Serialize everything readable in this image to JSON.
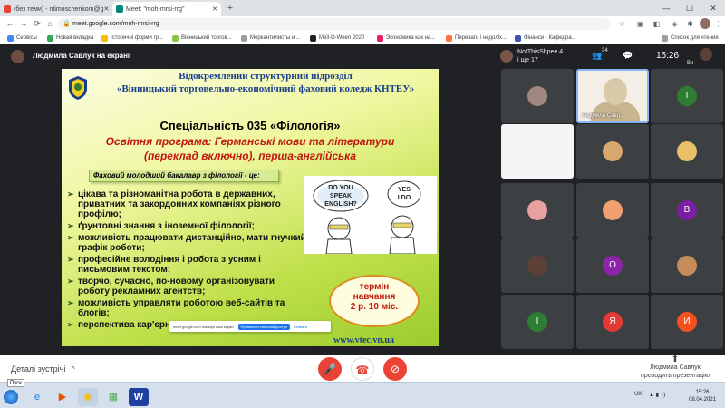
{
  "browser": {
    "tabs": [
      {
        "label": "(без теми) - ntimoschenkom@g",
        "favicon_color": "#ea4335"
      },
      {
        "label": "Meet: \"moh-mrsi-rrg\"",
        "favicon_color": "#00897b"
      }
    ],
    "new_tab": "+",
    "window_controls": {
      "minimize": "—",
      "maximize": "☐",
      "close": "✕"
    },
    "url": "meet.google.com/moh-mrsi-rrg",
    "lock_icon": "🔒",
    "nav": {
      "back": "←",
      "forward": "→",
      "reload": "⟳",
      "home": "⌂"
    },
    "toolbar_icons": {
      "star": "☆",
      "extensions": "⋮"
    }
  },
  "bookmarks": [
    {
      "label": "Сервісы",
      "color": "#4285f4"
    },
    {
      "label": "Новая вкладка",
      "color": "#34a853"
    },
    {
      "label": "Історичні форми гр...",
      "color": "#fbbc05"
    },
    {
      "label": "Вінницький торгов...",
      "color": "#8bc34a"
    },
    {
      "label": "Меркантилисты и ...",
      "color": "#9e9e9e"
    },
    {
      "label": "Mell-O-Ween 2020",
      "color": "#212121"
    },
    {
      "label": "Экономика как на...",
      "color": "#e91e63"
    },
    {
      "label": "Переваги і недоліх...",
      "color": "#ff7043"
    },
    {
      "label": "Фінанси - Кафедра...",
      "color": "#3f51b5"
    }
  ],
  "bookmarks_right": "Список для чтения",
  "meet": {
    "presenter_label": "Людмила Савлук на екрані",
    "right_header": {
      "name": "NotThisShpee 4...",
      "sub": "і ще 17",
      "people_count": "34",
      "time": "15:26",
      "self_name": "Ви"
    },
    "slide": {
      "header_line1": "Відокремлений структурний підрозділ",
      "header_line2": "«Вінницький торговельно-економічний фаховий коледж КНТЕУ»",
      "specialty": "Спеціальність 035 «Філологія»",
      "program_line1": "Освітня програма: Германські мови та літератури",
      "program_line2": "(переклад включно), перша-англійська",
      "bachelor": "Фаховий молодший бакалавр з філології - це:",
      "bullets": [
        [
          "цікава та різноманітна робота в державних,",
          "приватних та закордонних компаніях різного",
          "профілю;"
        ],
        [
          "ґрунтовні знання з іноземної філології;"
        ],
        [
          "можливість працювати дистанційно, мати гнучкий",
          "графік роботи;"
        ],
        [
          "професійне володіння і робота з усним і",
          "письмовим текстом;"
        ],
        [
          "творчо, сучасно, по-новому організовувати",
          "роботу рекламних агентств;"
        ],
        [
          "можливість управляти роботою веб-сайтів та",
          "блогів;"
        ],
        [
          "перспектива кар'єрного зростання"
        ]
      ],
      "cartoon_bubble1": "DO YOU SPEAK ENGLISH?",
      "cartoon_bubble2": "YES I DO",
      "term_line1": "термін",
      "term_line2": "навчання",
      "term_line3": "2 р. 10 міс.",
      "website": "www.vtec.vn.ua"
    },
    "share_notice": {
      "text": "meet.google.com показує ваш екран.",
      "button": "Припинити спільний доступ",
      "link": "Сховати"
    },
    "participants": [
      {
        "kind": "photo",
        "color": "#a1887f",
        "name": ""
      },
      {
        "kind": "letter",
        "letter": "I",
        "color": "#2e7d32",
        "name": ""
      },
      {
        "kind": "active",
        "name": "Людмила Савл..."
      },
      {
        "kind": "letter",
        "letter": "",
        "color": "#3c4043",
        "name": ""
      },
      {
        "kind": "white",
        "name": ""
      },
      {
        "kind": "photo",
        "color": "#8d6e63",
        "name": ""
      },
      {
        "kind": "photo",
        "color": "#d7a86e",
        "name": ""
      },
      {
        "kind": "photo",
        "color": "#6d4c41",
        "name": ""
      },
      {
        "kind": "photo",
        "color": "#e8a0a0",
        "name": ""
      },
      {
        "kind": "photo",
        "color": "#f0a070",
        "name": ""
      },
      {
        "kind": "letter",
        "letter": "В",
        "color": "#7b1fa2",
        "name": ""
      },
      {
        "kind": "photo",
        "color": "#5d4037",
        "name": ""
      },
      {
        "kind": "letter",
        "letter": "О",
        "color": "#8e24aa",
        "name": ""
      },
      {
        "kind": "photo",
        "color": "#c68b5a",
        "name": ""
      },
      {
        "kind": "letter",
        "letter": "I",
        "color": "#2e7d32",
        "name": ""
      },
      {
        "kind": "letter",
        "letter": "Я",
        "color": "#e53935",
        "name": ""
      },
      {
        "kind": "letter",
        "letter": "И",
        "color": "#f4511e",
        "name": ""
      }
    ]
  },
  "controls": {
    "details": "Деталі зустрічі",
    "details_chevron": "^",
    "mic_icon": "🎤",
    "hangup_icon": "☎",
    "camera_icon": "⊘",
    "present_icon": "⬆",
    "present_line1": "Людмила Савлук",
    "present_line2": "проводить презентацію"
  },
  "taskbar": {
    "tooltip": "Пуск",
    "apps": [
      {
        "icon": "e",
        "color": "#1e88e5",
        "name": "ie"
      },
      {
        "icon": "▶",
        "color": "#e65100",
        "name": "media"
      },
      {
        "icon": "◉",
        "color": "#fbbc05",
        "name": "chrome"
      },
      {
        "icon": "▦",
        "color": "#4caf50",
        "name": "sheets"
      },
      {
        "icon": "W",
        "color": "#1e40a0",
        "name": "word"
      }
    ],
    "lang": "UK",
    "time": "15:26",
    "date": "08.04.2021"
  }
}
